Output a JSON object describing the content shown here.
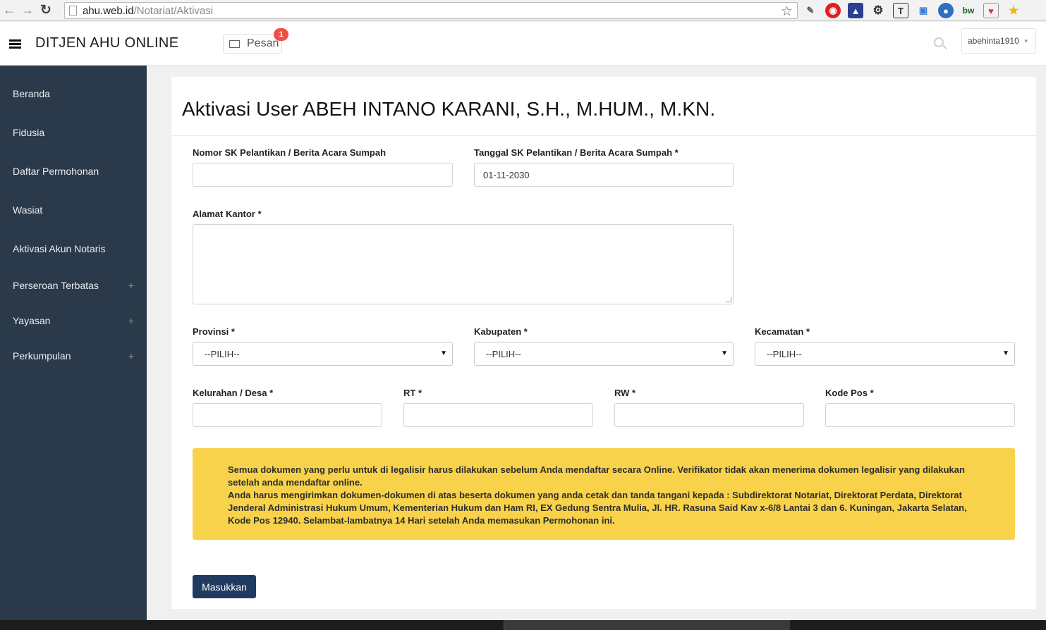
{
  "browser": {
    "url_host": "ahu.web.id",
    "url_path": "/Notariat/Aktivasi"
  },
  "header": {
    "brand": "DITJEN AHU ONLINE",
    "messages_label": "Pesan",
    "messages_count": "1",
    "username": "abehinta1910"
  },
  "sidebar": {
    "items": [
      {
        "label": "Beranda",
        "expandable": false
      },
      {
        "label": "Fidusia",
        "expandable": false
      },
      {
        "label": "Daftar Permohonan",
        "expandable": false
      },
      {
        "label": "Wasiat",
        "expandable": false
      },
      {
        "label": "Aktivasi Akun Notaris",
        "expandable": false
      },
      {
        "label": "Perseroan Terbatas",
        "expandable": true
      },
      {
        "label": "Yayasan",
        "expandable": true
      },
      {
        "label": "Perkumpulan",
        "expandable": true
      }
    ],
    "expand_symbol": "+"
  },
  "form": {
    "title": "Aktivasi User ABEH INTANO KARANI, S.H., M.HUM., M.KN.",
    "nomor_sk": {
      "label": "Nomor SK Pelantikan / Berita Acara Sumpah",
      "value": ""
    },
    "tanggal_sk": {
      "label": "Tanggal SK Pelantikan / Berita Acara Sumpah *",
      "value": "01-11-2030"
    },
    "alamat": {
      "label": "Alamat Kantor *",
      "value": ""
    },
    "provinsi": {
      "label": "Provinsi *",
      "selected": "--PILIH--"
    },
    "kabupaten": {
      "label": "Kabupaten *",
      "selected": "--PILIH--"
    },
    "kecamatan": {
      "label": "Kecamatan *",
      "selected": "--PILIH--"
    },
    "kelurahan": {
      "label": "Kelurahan / Desa *",
      "value": ""
    },
    "rt": {
      "label": "RT *",
      "value": ""
    },
    "rw": {
      "label": "RW *",
      "value": ""
    },
    "kode_pos": {
      "label": "Kode Pos *",
      "value": ""
    },
    "notice": {
      "line1": "Semua dokumen yang perlu untuk di legalisir harus dilakukan sebelum Anda mendaftar secara Online. Verifikator tidak akan menerima dokumen legalisir yang dilakukan setelah anda mendaftar online.",
      "line2": "Anda harus mengirimkan dokumen-dokumen di atas beserta dokumen yang anda cetak dan tanda tangani kepada : Subdirektorat Notariat, Direktorat Perdata, Direktorat Jenderal Administrasi Hukum Umum, Kementerian Hukum dan Ham RI, EX Gedung Sentra Mulia, Jl. HR. Rasuna Said Kav x-6/8 Lantai 3 dan 6. Kuningan, Jakarta Selatan, Kode Pos 12940. Selambat-lambatnya 14 Hari setelah Anda memasukan Permohonan ini."
    },
    "submit_label": "Masukkan"
  },
  "colors": {
    "sidebar_bg": "#2b3a4a",
    "notice_bg": "#f8d24a",
    "submit_bg": "#1f3b5f",
    "badge_bg": "#f04f45"
  },
  "icons": [
    "back-icon",
    "forward-icon",
    "reload-icon",
    "bookmark-star-icon",
    "menu-icon",
    "envelope-icon",
    "search-icon",
    "dropdown-caret-icon"
  ]
}
